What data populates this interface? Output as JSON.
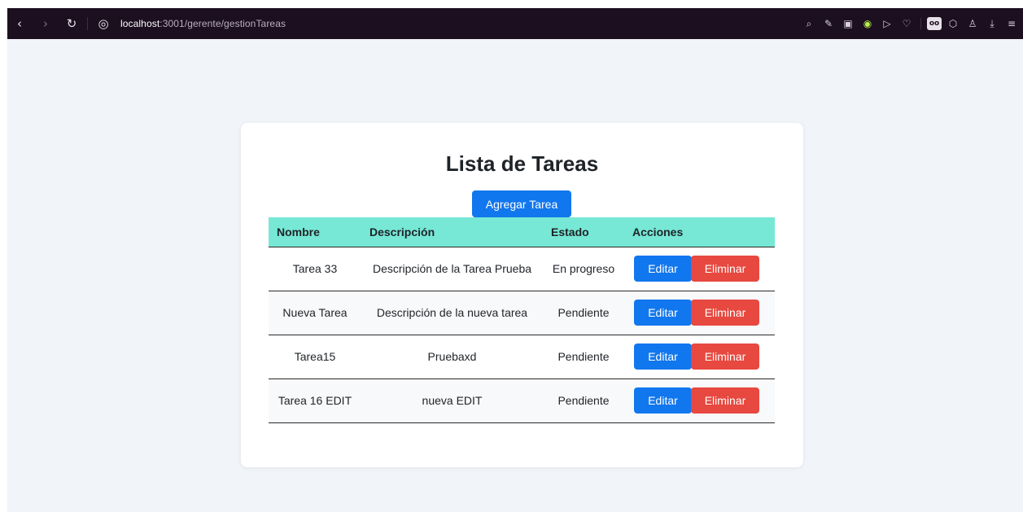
{
  "browser": {
    "url_host": "localhost",
    "url_path": ":3001/gerente/gestionTareas"
  },
  "colors": {
    "header_bg": "#76e8d5",
    "primary": "#1177ee",
    "danger": "#e7483f",
    "page_bg": "#f1f4f8"
  },
  "page": {
    "title": "Lista de Tareas",
    "add_button_label": "Agregar Tarea"
  },
  "table": {
    "headers": [
      "Nombre",
      "Descripción",
      "Estado",
      "Acciones"
    ],
    "rows": [
      {
        "nombre": "Tarea 33",
        "descripcion": "Descripción de la Tarea Prueba",
        "estado": "En progreso"
      },
      {
        "nombre": "Nueva Tarea",
        "descripcion": "Descripción de la nueva tarea",
        "estado": "Pendiente"
      },
      {
        "nombre": "Tarea15",
        "descripcion": "Pruebaxd",
        "estado": "Pendiente"
      },
      {
        "nombre": "Tarea 16 EDIT",
        "descripcion": "nueva EDIT",
        "estado": "Pendiente"
      }
    ],
    "edit_label": "Editar",
    "delete_label": "Eliminar"
  }
}
